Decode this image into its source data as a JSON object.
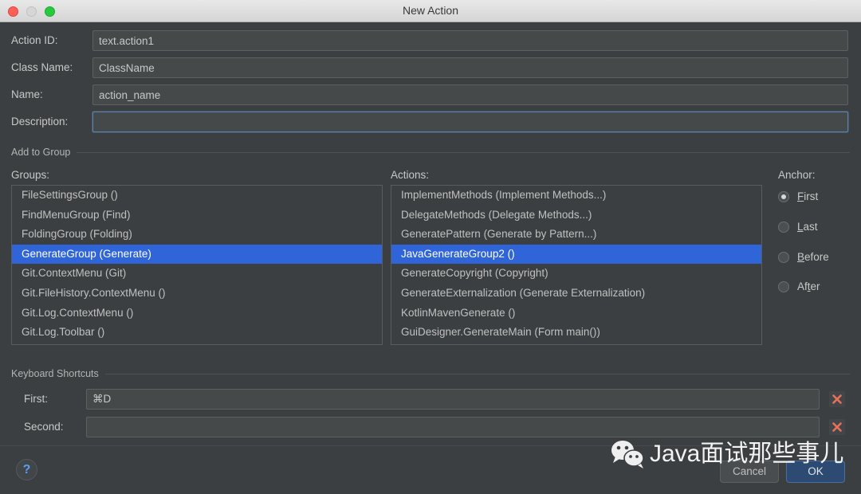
{
  "window": {
    "title": "New Action",
    "traffic_lights": [
      "close",
      "minimize",
      "zoom"
    ],
    "colors": {
      "background": "#3c3f41",
      "field_background": "#45494a",
      "selection_blue": "#2f65d8",
      "focus_border": "#5a84b0",
      "accent_help": "#589df6",
      "delete_red": "#e8705a",
      "default_button": "#2c4a72"
    }
  },
  "form": {
    "fields": [
      {
        "label": "Action ID:",
        "value": "text.action1",
        "placeholder": "",
        "focused": false
      },
      {
        "label": "Class Name:",
        "value": "ClassName",
        "placeholder": "",
        "focused": false
      },
      {
        "label": "Name:",
        "value": "action_name",
        "placeholder": "",
        "focused": false
      },
      {
        "label": "Description:",
        "value": "",
        "placeholder": "",
        "focused": true
      }
    ]
  },
  "add_to_group": {
    "section_title": "Add to Group",
    "groups_caption": "Groups:",
    "groups": [
      {
        "label": "FileSettingsGroup ()",
        "selected": false
      },
      {
        "label": "FindMenuGroup (Find)",
        "selected": false
      },
      {
        "label": "FoldingGroup (Folding)",
        "selected": false
      },
      {
        "label": "GenerateGroup (Generate)",
        "selected": true
      },
      {
        "label": "Git.ContextMenu (Git)",
        "selected": false
      },
      {
        "label": "Git.FileHistory.ContextMenu ()",
        "selected": false
      },
      {
        "label": "Git.Log.ContextMenu ()",
        "selected": false
      },
      {
        "label": "Git.Log.Toolbar ()",
        "selected": false
      }
    ],
    "actions_caption": "Actions:",
    "actions": [
      {
        "label": "ImplementMethods (Implement Methods...)",
        "selected": false
      },
      {
        "label": "DelegateMethods (Delegate Methods...)",
        "selected": false
      },
      {
        "label": "GeneratePattern (Generate by Pattern...)",
        "selected": false
      },
      {
        "label": "JavaGenerateGroup2 ()",
        "selected": true
      },
      {
        "label": "GenerateCopyright (Copyright)",
        "selected": false
      },
      {
        "label": "GenerateExternalization (Generate Externalization)",
        "selected": false
      },
      {
        "label": "KotlinMavenGenerate ()",
        "selected": false
      },
      {
        "label": "GuiDesigner.GenerateMain (Form main())",
        "selected": false
      }
    ],
    "anchor_caption": "Anchor:",
    "anchor_options": [
      {
        "label": "First",
        "mnemonic_index": 0,
        "selected": true
      },
      {
        "label": "Last",
        "mnemonic_index": 0,
        "selected": false
      },
      {
        "label": "Before",
        "mnemonic_index": 0,
        "selected": false
      },
      {
        "label": "After",
        "mnemonic_index": 2,
        "selected": false
      }
    ]
  },
  "keyboard_shortcuts": {
    "section_title": "Keyboard Shortcuts",
    "rows": [
      {
        "label": "First:",
        "value": "⌘D",
        "clear_icon": "close-x-icon"
      },
      {
        "label": "Second:",
        "value": "",
        "clear_icon": "close-x-icon"
      }
    ]
  },
  "footer": {
    "help_label": "?",
    "cancel_label": "Cancel",
    "ok_label": "OK"
  },
  "watermark": {
    "logo": "wechat-icon",
    "text": "Java面试那些事儿"
  }
}
